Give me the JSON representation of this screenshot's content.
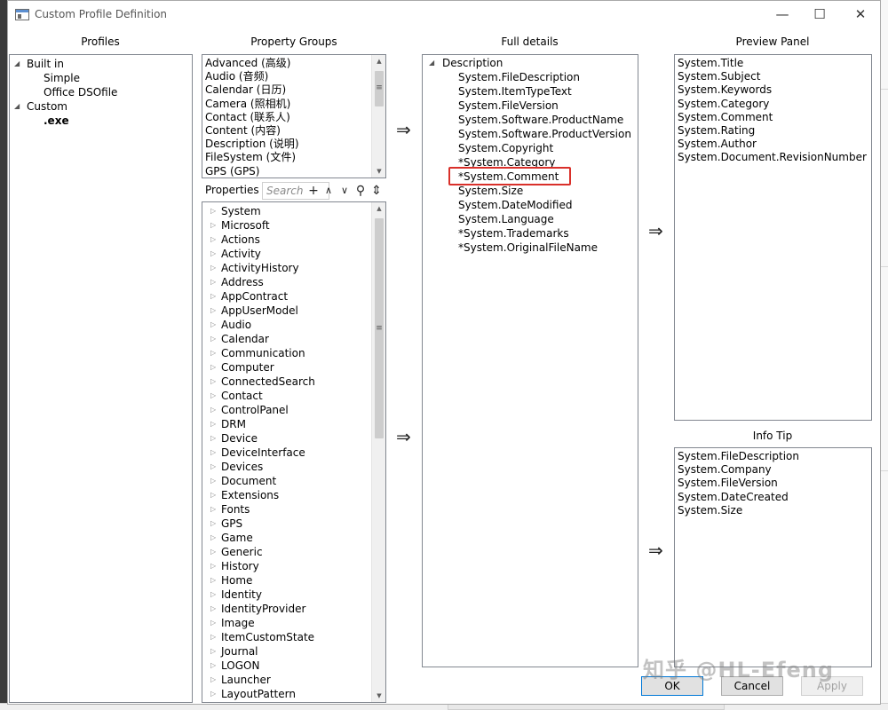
{
  "window": {
    "title": "Custom Profile Definition",
    "minimize": "—",
    "maximize": "☐",
    "close": "✕"
  },
  "headers": {
    "profiles": "Profiles",
    "property_groups": "Property Groups",
    "full_details": "Full details",
    "preview_panel": "Preview Panel",
    "info_tip": "Info Tip"
  },
  "profiles": [
    {
      "label": "Built in",
      "level": 0,
      "expanded": true,
      "bold": false
    },
    {
      "label": "Simple",
      "level": 1,
      "expanded": null,
      "bold": false
    },
    {
      "label": "Office DSOfile",
      "level": 1,
      "expanded": null,
      "bold": false
    },
    {
      "label": "Custom",
      "level": 0,
      "expanded": true,
      "bold": false
    },
    {
      "label": ".exe",
      "level": 1,
      "expanded": null,
      "bold": true
    }
  ],
  "property_groups": [
    "Advanced (高级)",
    "Audio (音频)",
    "Calendar (日历)",
    "Camera (照相机)",
    "Contact (联系人)",
    "Content (内容)",
    "Description (说明)",
    "FileSystem (文件)",
    "GPS (GPS)"
  ],
  "properties_toolbar": {
    "label": "Properties",
    "search_placeholder": "Search",
    "add": "+",
    "up": "∧",
    "down": "∨",
    "find": "⚲",
    "expand": "⇕"
  },
  "properties": [
    "System",
    "Microsoft",
    "Actions",
    "Activity",
    "ActivityHistory",
    "Address",
    "AppContract",
    "AppUserModel",
    "Audio",
    "Calendar",
    "Communication",
    "Computer",
    "ConnectedSearch",
    "Contact",
    "ControlPanel",
    "DRM",
    "Device",
    "DeviceInterface",
    "Devices",
    "Document",
    "Extensions",
    "Fonts",
    "GPS",
    "Game",
    "Generic",
    "History",
    "Home",
    "Identity",
    "IdentityProvider",
    "Image",
    "ItemCustomState",
    "Journal",
    "LOGON",
    "Launcher",
    "LayoutPattern"
  ],
  "full_details": {
    "group": "Description",
    "items": [
      "System.FileDescription",
      "System.ItemTypeText",
      "System.FileVersion",
      "System.Software.ProductName",
      "System.Software.ProductVersion",
      "System.Copyright",
      "*System.Category",
      "*System.Comment",
      "System.Size",
      "System.DateModified",
      "System.Language",
      "*System.Trademarks",
      "*System.OriginalFileName"
    ],
    "highlighted_index": 7
  },
  "preview_panel": [
    "System.Title",
    "System.Subject",
    "System.Keywords",
    "System.Category",
    "System.Comment",
    "System.Rating",
    "System.Author",
    "System.Document.RevisionNumber"
  ],
  "info_tip": [
    "System.FileDescription",
    "System.Company",
    "System.FileVersion",
    "System.DateCreated",
    "System.Size"
  ],
  "transfer_arrow": "⇒",
  "buttons": {
    "ok": "OK",
    "cancel": "Cancel",
    "apply": "Apply"
  },
  "watermark": "知乎 @HL-Efeng",
  "colors": {
    "highlight": "#d9302a",
    "border": "#828790",
    "ok_border": "#0078d7"
  }
}
